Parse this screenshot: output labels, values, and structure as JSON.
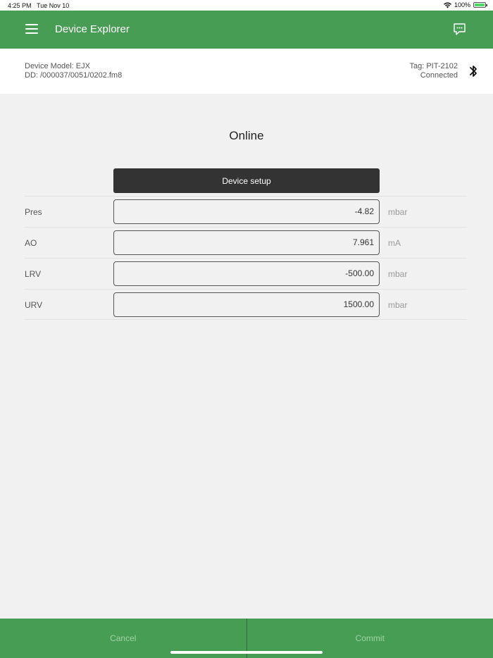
{
  "status_bar": {
    "time": "4:25 PM",
    "date": "Tue Nov 10",
    "battery": "100%",
    "battery_level": 1.0
  },
  "header": {
    "title": "Device Explorer",
    "menu_icon": "hamburger-menu-icon",
    "action_icon": "chat-icon"
  },
  "device_info": {
    "model": "Device Model:  EJX",
    "dd": "DD: /000037/0051/0202.fm8",
    "tag": "Tag:  PIT-2102",
    "status": "Connected",
    "connection_icon": "bluetooth-icon"
  },
  "main": {
    "title": "Online",
    "setup_button": "Device setup",
    "params": [
      {
        "label": "Pres",
        "value": "-4.82",
        "unit": "mbar"
      },
      {
        "label": "AO",
        "value": "7.961",
        "unit": "mA"
      },
      {
        "label": "LRV",
        "value": "-500.00",
        "unit": "mbar"
      },
      {
        "label": "URV",
        "value": "1500.00",
        "unit": "mbar"
      }
    ]
  },
  "footer": {
    "cancel": "Cancel",
    "commit": "Commit"
  },
  "colors": {
    "primary": "#479d53",
    "dark_button": "#333333",
    "background": "#f1f1f1"
  }
}
